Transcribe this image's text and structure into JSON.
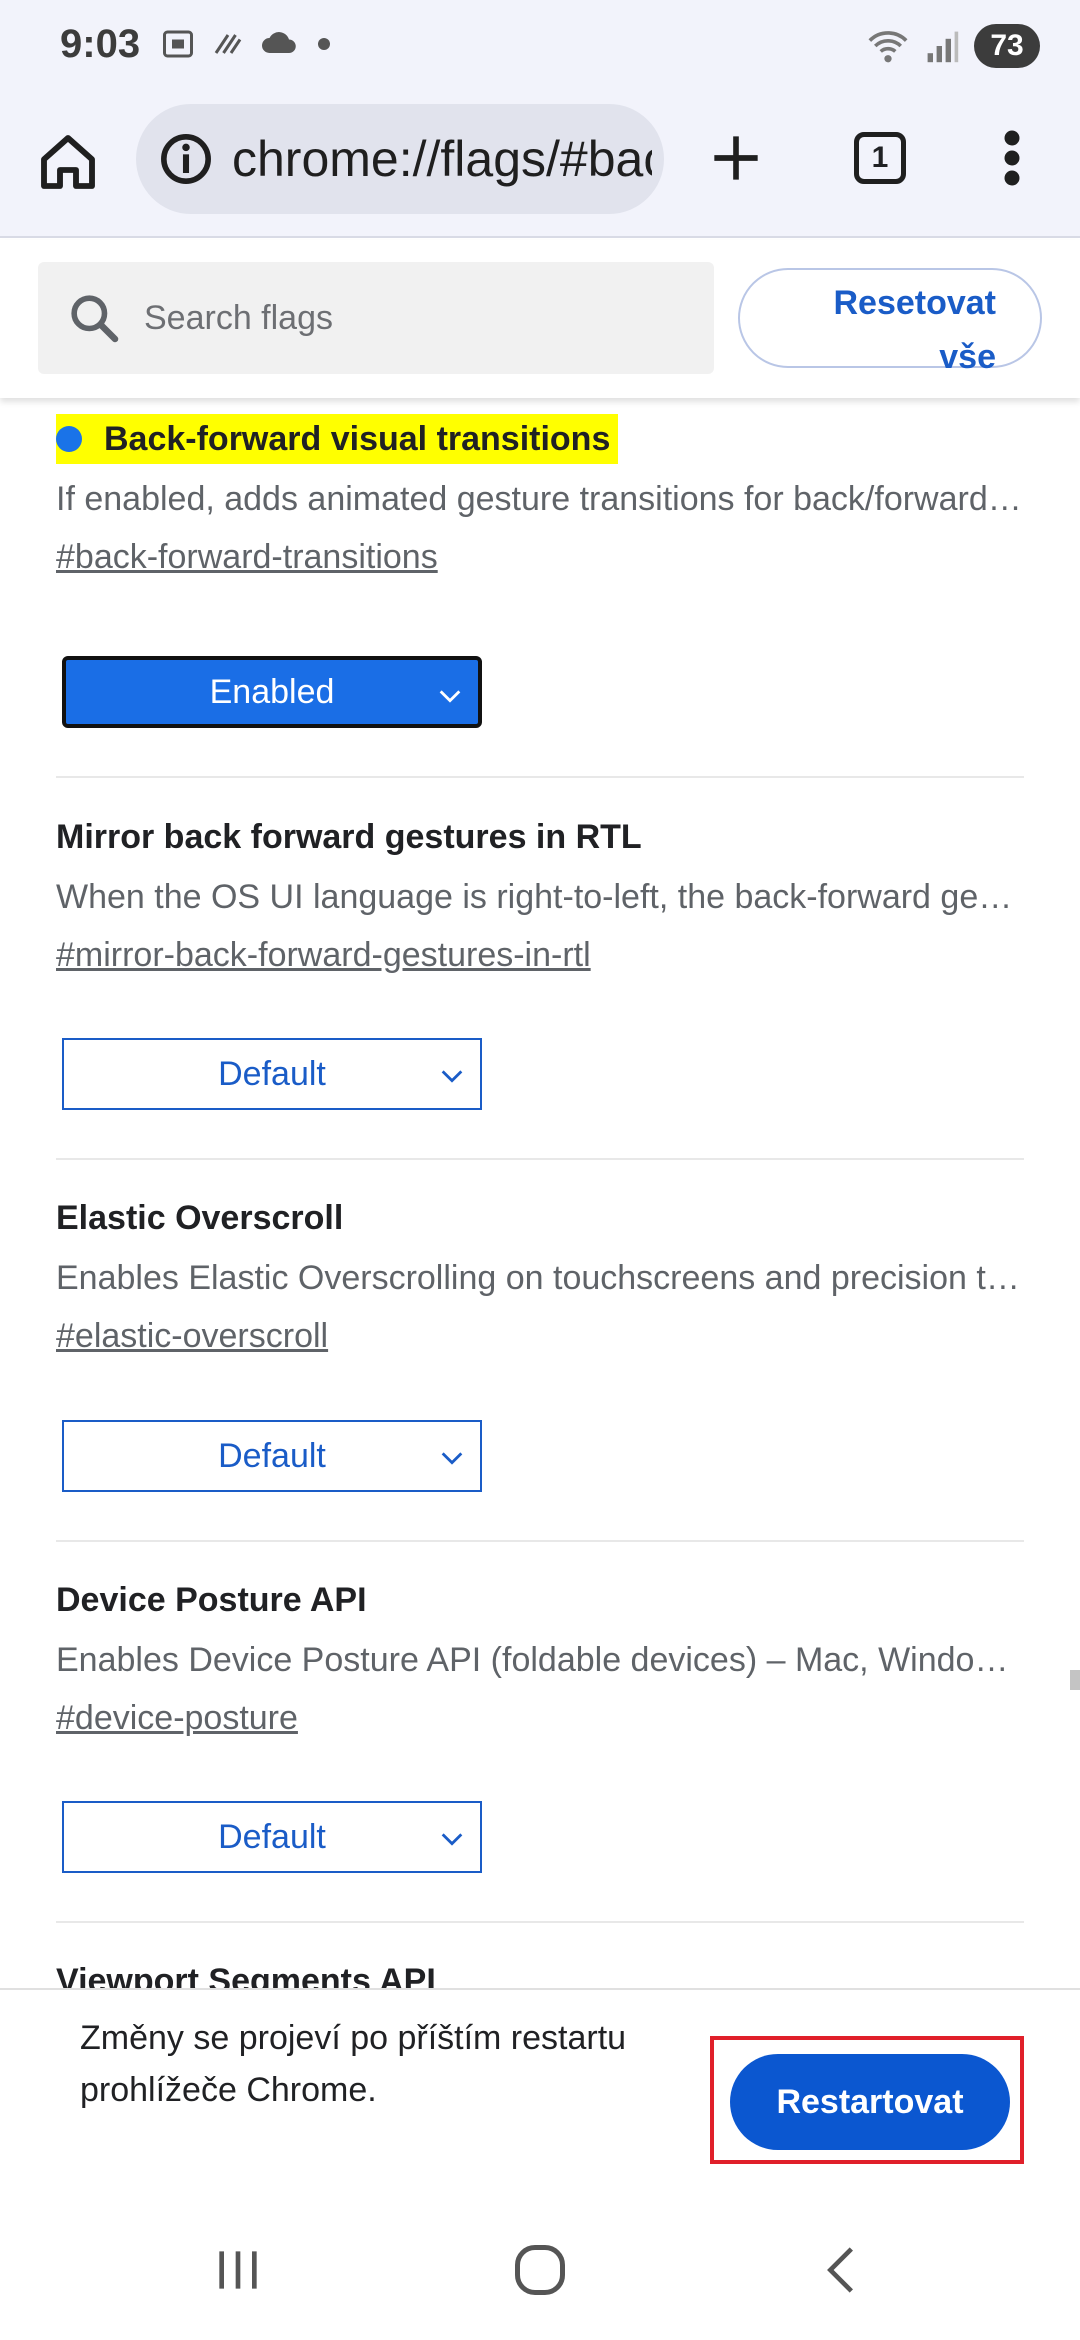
{
  "status_bar": {
    "time": "9:03",
    "battery": "73",
    "left_icons": [
      "screenshot-icon",
      "nfc-icon",
      "cloud-icon",
      "dot-icon"
    ],
    "right_icons": [
      "wifi-icon",
      "signal-icon"
    ]
  },
  "toolbar": {
    "url": "chrome://flags/#back-forward-transitions",
    "tab_count": "1"
  },
  "search": {
    "placeholder": "Search flags",
    "reset_label": "Resetovat\nvše"
  },
  "flags": [
    {
      "title": "Back-forward visual transitions",
      "description": "If enabled, adds animated gesture transitions for back/forward navigation.",
      "link": "#back-forward-transitions",
      "value": "Enabled",
      "highlighted": true
    },
    {
      "title": "Mirror back forward gestures in RTL",
      "description": "When the OS UI language is right-to-left, the back-forward gestures are mirrored.",
      "link": "#mirror-back-forward-gestures-in-rtl",
      "value": "Default"
    },
    {
      "title": "Elastic Overscroll",
      "description": "Enables Elastic Overscrolling on touchscreens and precision touchpads.",
      "link": "#elastic-overscroll",
      "value": "Default"
    },
    {
      "title": "Device Posture API",
      "description": "Enables Device Posture API (foldable devices) – Mac, Windows, Linux, ChromeOS, Android",
      "link": "#device-posture",
      "value": "Default"
    },
    {
      "title": "Viewport Segments API"
    }
  ],
  "restart": {
    "message": "Změny se projeví po příštím restartu prohlížeče Chrome.",
    "button": "Restartovat"
  },
  "colors": {
    "accent": "#1a5cc7",
    "highlight": "#ffff00",
    "restart_outline": "#e0202a"
  }
}
